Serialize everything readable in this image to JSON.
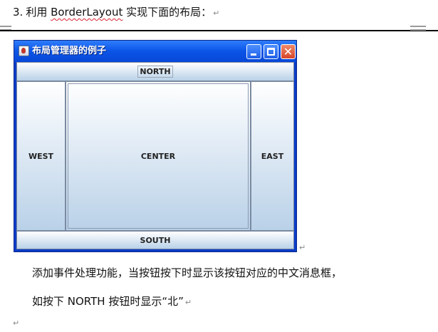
{
  "heading": {
    "number": "3.",
    "prefix": "利用 ",
    "keyword": "BorderLayout",
    "suffix": " 实现下面的布局："
  },
  "paragraph_mark": "↵",
  "window": {
    "title": "布局管理器的例子",
    "buttons": {
      "north": "NORTH",
      "west": "WEST",
      "center": "CENTER",
      "east": "EAST",
      "south": "SOUTH"
    },
    "controls": {
      "close_glyph": "✕"
    }
  },
  "body": {
    "line1": "添加事件处理功能，当按钮按下时显示该按钮对应的中文消息框，",
    "line2": "如按下 NORTH 按钮时显示“北”"
  }
}
